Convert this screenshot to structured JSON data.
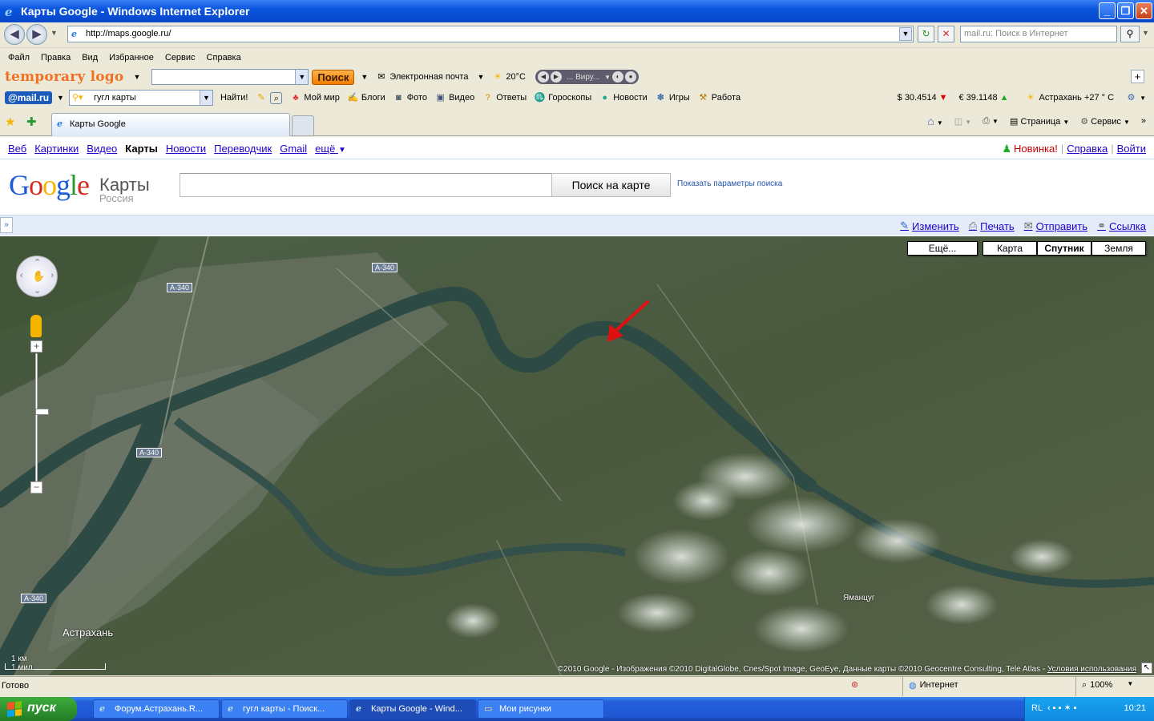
{
  "window": {
    "title": "Карты Google - Windows Internet Explorer"
  },
  "address": {
    "url": "http://maps.google.ru/",
    "search_placeholder": "mail.ru: Поиск в Интернет"
  },
  "menu": [
    "Файл",
    "Правка",
    "Вид",
    "Избранное",
    "Сервис",
    "Справка"
  ],
  "toolbar1": {
    "logo": "temporary logo",
    "search_button": "Поиск",
    "email": "Электронная почта",
    "temperature": "20°C",
    "player_text": "... Виру..."
  },
  "toolbar2": {
    "brand": "@mail.ru",
    "query": "гугл карты",
    "find": "Найти!",
    "links": [
      "Мой мир",
      "Блоги",
      "Фото",
      "Видео",
      "Ответы",
      "Гороскопы",
      "Новости",
      "Игры",
      "Работа"
    ],
    "usd": "$ 30.4514",
    "eur": "€ 39.1148",
    "weather": "Астрахань +27 ° C"
  },
  "tab": {
    "title": "Карты Google"
  },
  "commands": [
    "Страница",
    "Сервис"
  ],
  "gbar": {
    "links": [
      "Веб",
      "Картинки",
      "Видео",
      "Карты",
      "Новости",
      "Переводчик",
      "Gmail",
      "ещё"
    ],
    "active": "Карты",
    "new": "Новинка!",
    "help": "Справка",
    "login": "Войти"
  },
  "maps": {
    "logo_letters": [
      "G",
      "o",
      "o",
      "g",
      "l",
      "e"
    ],
    "product": "Карты",
    "region": "Россия",
    "search_button": "Поиск на карте",
    "show_params": "Показать параметры поиска",
    "actions": [
      "Изменить",
      "Печать",
      "Отправить",
      "Ссылка"
    ],
    "map_types": [
      "Ещё...",
      "Карта",
      "Спутник",
      "Земля"
    ],
    "active_type": "Спутник"
  },
  "map": {
    "labels": {
      "road": "А-340",
      "city": "Астрахань",
      "village": "Яманцуг"
    },
    "scale_km": "1 км",
    "scale_mi": "1 мил.",
    "copyright": "©2010 Google - Изображения ©2010 DigitalGlobe, Cnes/Spot Image, GeoEye, Данные карты ©2010 Geocentre Consulting, Tele Atlas - ",
    "terms": "Условия использования"
  },
  "status": {
    "text": "Готово",
    "zone": "Интернет",
    "zoom": "100%"
  },
  "taskbar": {
    "start": "пуск",
    "tasks": [
      "Форум.Астрахань.R...",
      "гугл карты - Поиск...",
      "Карты Google - Wind...",
      "Мои рисунки"
    ],
    "lang": "RL",
    "clock": "10:21"
  },
  "colors": {
    "accent": "#0a55e0",
    "link": "#2200cc",
    "logo_orange": "#f37021",
    "water": "#2e4a44",
    "land": "#4a5a3e"
  }
}
